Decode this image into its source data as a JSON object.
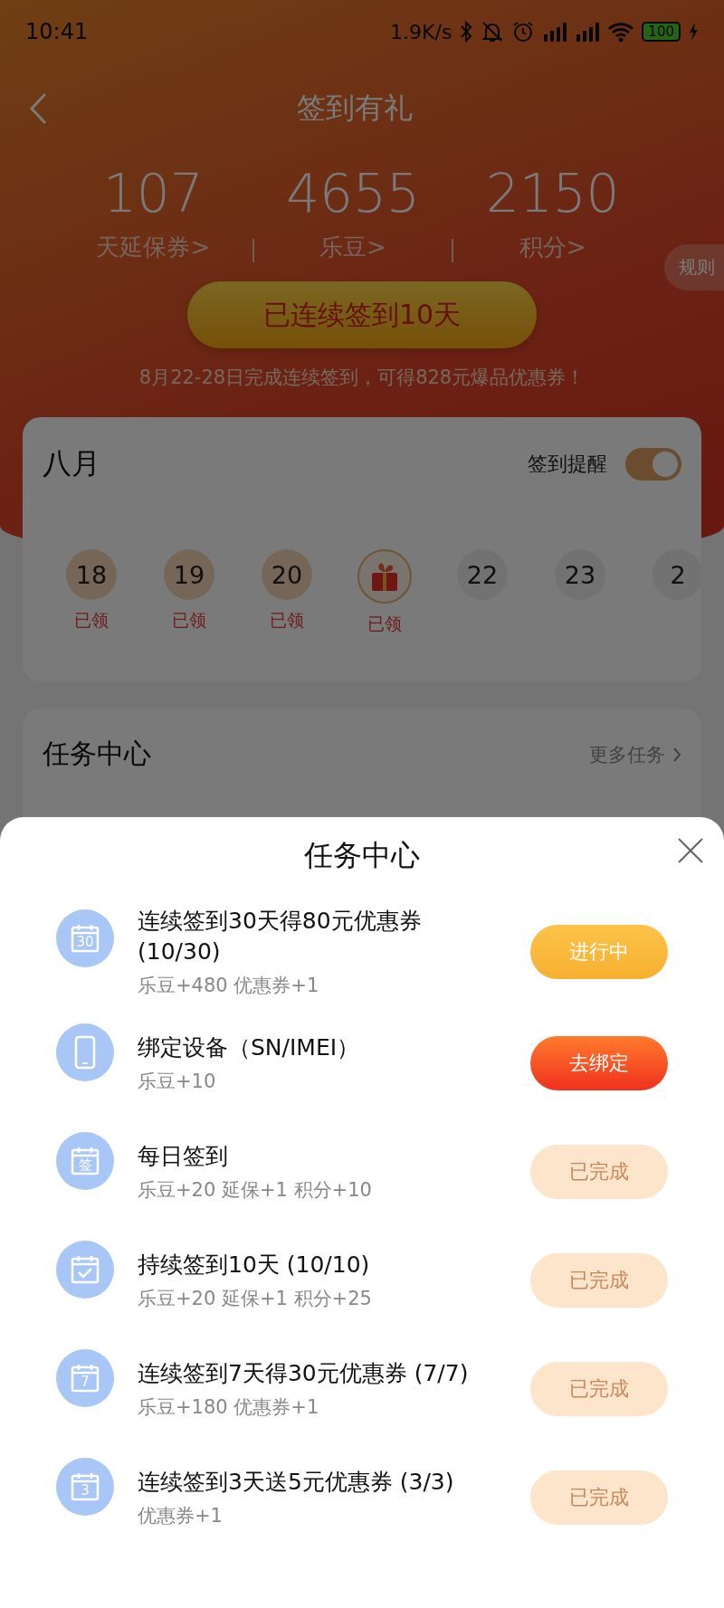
{
  "status_bar": {
    "time": "10:41",
    "speed": "1.9K/s",
    "battery": "100"
  },
  "header": {
    "title": "签到有礼"
  },
  "stats": [
    {
      "value": "107",
      "label": "天延保券>"
    },
    {
      "value": "4655",
      "label": "乐豆>"
    },
    {
      "value": "2150",
      "label": "积分>"
    }
  ],
  "rules_tab": "规则",
  "streak_button": "已连续签到10天",
  "notice": "8月22-28日完成连续签到，可得828元爆品优惠券！",
  "calendar": {
    "month": "八月",
    "reminder_label": "签到提醒",
    "reminder_on": true,
    "days": [
      {
        "kind": "day",
        "number": "18",
        "claimed": true,
        "status": "已领"
      },
      {
        "kind": "day",
        "number": "19",
        "claimed": true,
        "status": "已领"
      },
      {
        "kind": "day",
        "number": "20",
        "claimed": true,
        "status": "已领"
      },
      {
        "kind": "gift",
        "claimed": true,
        "status": "已领"
      },
      {
        "kind": "day",
        "number": "22",
        "claimed": false
      },
      {
        "kind": "day",
        "number": "23",
        "claimed": false
      },
      {
        "kind": "day",
        "number": "2",
        "claimed": false
      }
    ]
  },
  "task_card": {
    "title": "任务中心",
    "more": "更多任务"
  },
  "task_sheet": {
    "title": "任务中心",
    "tasks": [
      {
        "kind": "calendar",
        "icon_label": "30",
        "title": "连续签到30天得80元优惠券 (10/30)",
        "reward": "乐豆+480 优惠券+1",
        "button": {
          "label": "进行中",
          "kind": "progress"
        }
      },
      {
        "kind": "device",
        "title": "绑定设备（SN/IMEI）",
        "reward": "乐豆+10",
        "button": {
          "label": "去绑定",
          "kind": "action"
        }
      },
      {
        "kind": "calendar",
        "icon_label": "签",
        "title": "每日签到",
        "reward": "乐豆+20 延保+1 积分+10",
        "button": {
          "label": "已完成",
          "kind": "done"
        }
      },
      {
        "kind": "checkin",
        "title": "持续签到10天 (10/10)",
        "reward": "乐豆+20 延保+1 积分+25",
        "button": {
          "label": "已完成",
          "kind": "done"
        }
      },
      {
        "kind": "calendar",
        "icon_label": "7",
        "title": "连续签到7天得30元优惠券 (7/7)",
        "reward": "乐豆+180 优惠券+1",
        "button": {
          "label": "已完成",
          "kind": "done"
        }
      },
      {
        "kind": "calendar",
        "icon_label": "3",
        "title": "连续签到3天送5元优惠券 (3/3)",
        "reward": "优惠券+1",
        "button": {
          "label": "已完成",
          "kind": "done"
        }
      }
    ]
  }
}
